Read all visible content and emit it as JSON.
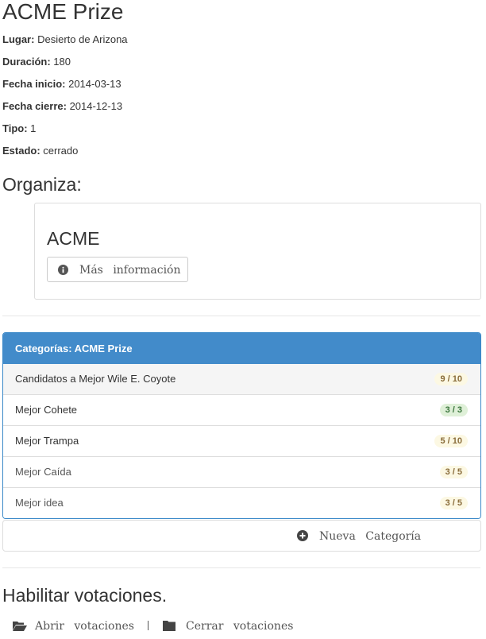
{
  "title": "ACME Prize",
  "details": [
    {
      "label": "Lugar:",
      "value": "Desierto de Arizona"
    },
    {
      "label": "Duración:",
      "value": "180"
    },
    {
      "label": "Fecha inicio:",
      "value": "2014-03-13"
    },
    {
      "label": "Fecha cierre:",
      "value": "2014-12-13"
    },
    {
      "label": "Tipo:",
      "value": "1"
    },
    {
      "label": "Estado:",
      "value": "cerrado"
    }
  ],
  "organiza": {
    "heading": "Organiza:",
    "name": "ACME",
    "button_label": "Más información",
    "button_icon": "info-circle-icon"
  },
  "categories": {
    "header": "Categorías: ACME Prize",
    "items": [
      {
        "name": "Candidatos a Mejor Wile E. Coyote",
        "count": "9 / 10",
        "status": "warning"
      },
      {
        "name": "Mejor Cohete",
        "count": "3 / 3",
        "status": "success"
      },
      {
        "name": "Mejor Trampa",
        "count": "5 / 10",
        "status": "warning"
      },
      {
        "name": "Mejor Caída",
        "count": "3 / 5",
        "status": "warning"
      },
      {
        "name": "Mejor idea",
        "count": "3 / 5",
        "status": "warning"
      }
    ],
    "new_label": "Nueva Categoría",
    "new_icon": "plus-circle-icon"
  },
  "votaciones": {
    "heading": "Habilitar votaciones.",
    "open_label": "Abrir votaciones",
    "open_icon": "folder-open-icon",
    "close_label": "Cerrar votaciones",
    "close_icon": "folder-icon"
  },
  "colors": {
    "panel_header": "#428bca",
    "badge_warning_bg": "#fcf8e3",
    "badge_warning_text": "#8a6d3b",
    "badge_success_bg": "#dff0d8",
    "badge_success_text": "#3c763d"
  }
}
